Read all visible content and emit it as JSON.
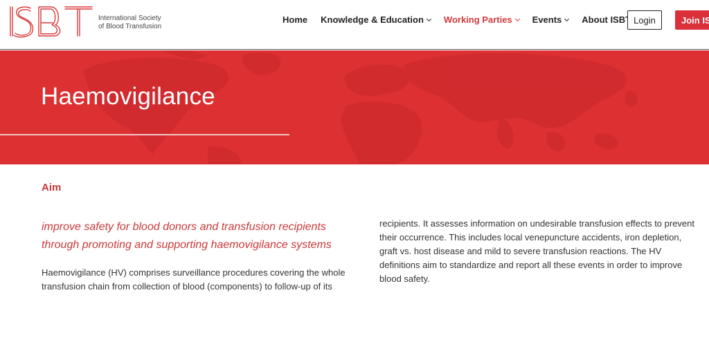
{
  "brand": {
    "logo_name": "ISBT",
    "line1": "International Society",
    "line2": "of Blood Transfusion"
  },
  "nav": {
    "items": [
      {
        "label": "Home",
        "dropdown": false,
        "active": false
      },
      {
        "label": "Knowledge & Education",
        "dropdown": true,
        "active": false
      },
      {
        "label": "Working Parties",
        "dropdown": true,
        "active": true
      },
      {
        "label": "Events",
        "dropdown": true,
        "active": false
      },
      {
        "label": "About ISBT",
        "dropdown": true,
        "active": false
      }
    ],
    "login_label": "Login",
    "join_label": "Join ISBT"
  },
  "hero": {
    "title": "Haemovigilance"
  },
  "content": {
    "section_heading": "Aim",
    "lead": "improve safety for blood donors and transfusion recipients through promoting and supporting haemovigilance systems",
    "paragraph_start": "Haemovigilance (HV) comprises surveillance procedures covering the whole transfusion chain from collection of blood (components) to follow-up of its",
    "paragraph_continued": "recipients. It assesses information on undesirable transfusion effects to prevent their occurrence. This includes local venepuncture accidents, iron depletion, graft vs. host disease and mild to severe transfusion reactions. The HV definitions aim to standardize and report all these events in order to improve blood safety."
  },
  "colors": {
    "accent": "#dc3033",
    "heading_red": "#c8383a",
    "text": "#333333",
    "nav_text": "#222222"
  }
}
